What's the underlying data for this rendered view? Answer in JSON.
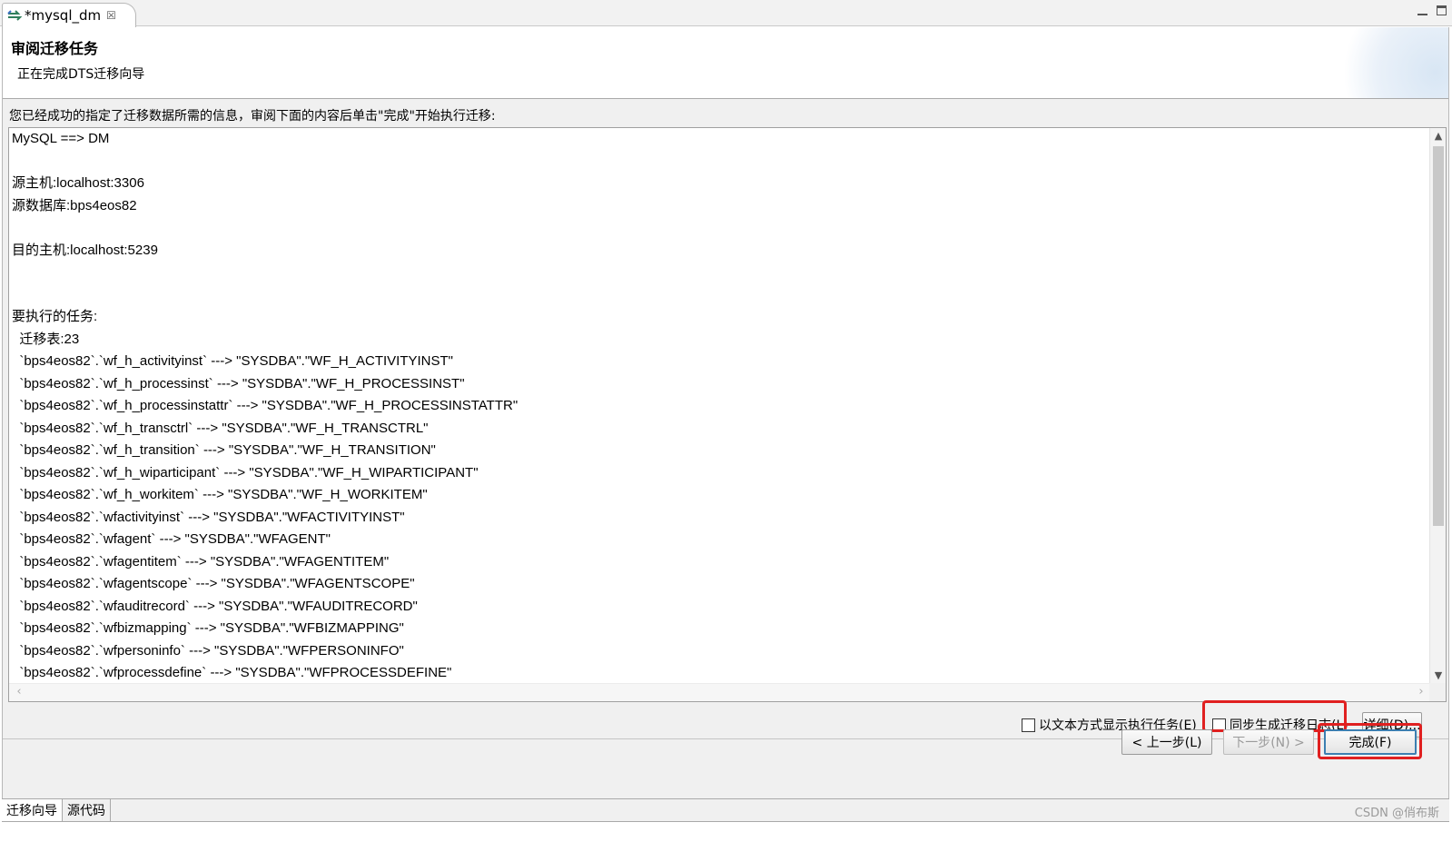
{
  "editor_tab": {
    "title": "*mysql_dm",
    "close_glyph": "☒",
    "icon": "migration-arrows-icon"
  },
  "window_controls": {
    "minimize": "minimize-icon",
    "maximize": "maximize-icon"
  },
  "wizard": {
    "title": "审阅迁移任务",
    "description": "正在完成DTS迁移向导",
    "instruction": "您已经成功的指定了迁移数据所需的信息，审阅下面的内容后单击\"完成\"开始执行迁移:"
  },
  "summary_lines": [
    "MySQL ==> DM",
    "",
    "源主机:localhost:3306",
    "源数据库:bps4eos82",
    "",
    "目的主机:localhost:5239",
    "",
    "",
    "要执行的任务:",
    "  迁移表:23",
    "  `bps4eos82`.`wf_h_activityinst` ---> \"SYSDBA\".\"WF_H_ACTIVITYINST\"",
    "  `bps4eos82`.`wf_h_processinst` ---> \"SYSDBA\".\"WF_H_PROCESSINST\"",
    "  `bps4eos82`.`wf_h_processinstattr` ---> \"SYSDBA\".\"WF_H_PROCESSINSTATTR\"",
    "  `bps4eos82`.`wf_h_transctrl` ---> \"SYSDBA\".\"WF_H_TRANSCTRL\"",
    "  `bps4eos82`.`wf_h_transition` ---> \"SYSDBA\".\"WF_H_TRANSITION\"",
    "  `bps4eos82`.`wf_h_wiparticipant` ---> \"SYSDBA\".\"WF_H_WIPARTICIPANT\"",
    "  `bps4eos82`.`wf_h_workitem` ---> \"SYSDBA\".\"WF_H_WORKITEM\"",
    "  `bps4eos82`.`wfactivityinst` ---> \"SYSDBA\".\"WFACTIVITYINST\"",
    "  `bps4eos82`.`wfagent` ---> \"SYSDBA\".\"WFAGENT\"",
    "  `bps4eos82`.`wfagentitem` ---> \"SYSDBA\".\"WFAGENTITEM\"",
    "  `bps4eos82`.`wfagentscope` ---> \"SYSDBA\".\"WFAGENTSCOPE\"",
    "  `bps4eos82`.`wfauditrecord` ---> \"SYSDBA\".\"WFAUDITRECORD\"",
    "  `bps4eos82`.`wfbizmapping` ---> \"SYSDBA\".\"WFBIZMAPPING\"",
    "  `bps4eos82`.`wfpersoninfo` ---> \"SYSDBA\".\"WFPERSONINFO\"",
    "  `bps4eos82`.`wfprocessdefine` ---> \"SYSDBA\".\"WFPROCESSDEFINE\""
  ],
  "options": {
    "show_as_text": {
      "label": "以文本方式显示执行任务(E)",
      "checked": false
    },
    "sync_log": {
      "label": "同步生成迁移日志(L)",
      "checked": false
    },
    "detail_button": "详细(D)..."
  },
  "nav": {
    "back": "< 上一步(L)",
    "next": "下一步(N) >",
    "finish": "完成(F)"
  },
  "bottom_tabs": [
    {
      "label": "迁移向导",
      "active": true
    },
    {
      "label": "源代码",
      "active": false
    }
  ],
  "watermark": "CSDN @俏布斯",
  "colors": {
    "highlight": "#e02020",
    "default_button_border": "#3c7fb1"
  }
}
